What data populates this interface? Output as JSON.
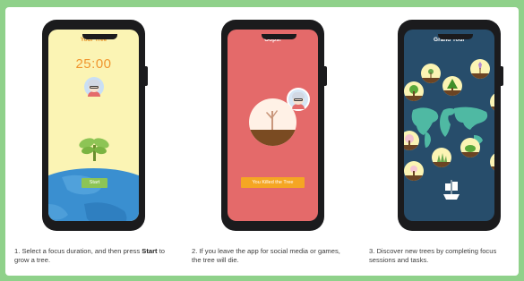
{
  "panels": [
    {
      "screen_title": "Your Tree",
      "timer": "25:00",
      "button": "Start",
      "caption_pre": "1. Select a focus duration, and then press ",
      "caption_bold": "Start",
      "caption_post": " to grow a tree."
    },
    {
      "screen_title": "Oops!",
      "button": "You Killed the Tree",
      "caption": "2. If you leave the app for social media or games, the tree will die."
    },
    {
      "screen_title": "Grand Tour",
      "caption": "3. Discover new trees by completing focus sessions and tasks."
    }
  ],
  "colors": {
    "background": "#8fd18a",
    "panel1_screen": "#fbf4b4",
    "panel2_screen": "#e46a6a",
    "panel3_screen": "#274d6b",
    "accent_orange": "#f0962f",
    "start_green": "#8dc455"
  }
}
